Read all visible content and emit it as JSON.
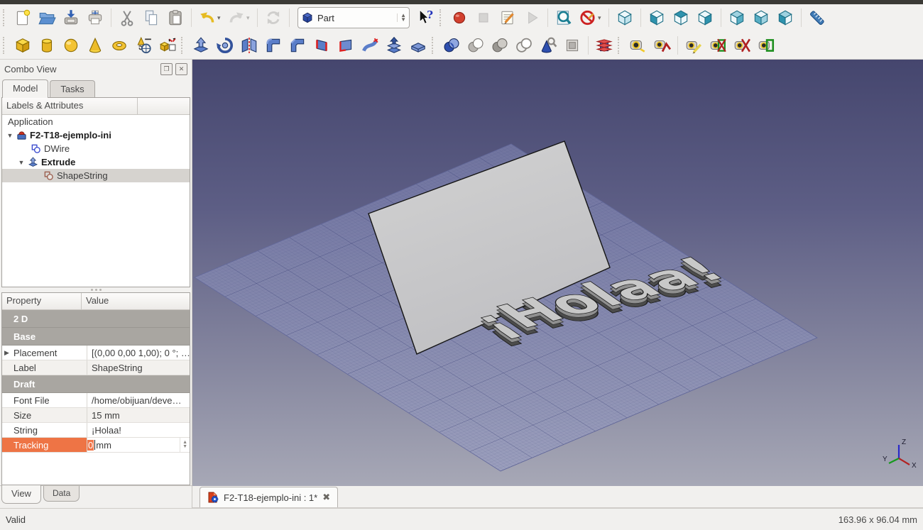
{
  "toolbar": {
    "workbench": {
      "value": "Part"
    },
    "row1_icons": [
      "new-document",
      "open-folder",
      "save",
      "print",
      "cut",
      "copy",
      "paste",
      "undo",
      "redo",
      "refresh",
      "workbench-selector",
      "whats-this",
      "macro-record",
      "macro-stop",
      "macro-edit",
      "macro-play",
      "zoom-fit",
      "draw-style",
      "view-isometric",
      "view-front",
      "view-top",
      "view-right",
      "view-rear",
      "view-bottom",
      "view-left",
      "measure"
    ],
    "row2_icons": [
      "box",
      "cylinder",
      "sphere",
      "cone",
      "torus",
      "create-primitives",
      "shape-builder",
      "extrude",
      "revolve",
      "mirror",
      "fillet",
      "chamfer",
      "ruled-surface",
      "make-face",
      "loft",
      "sweep",
      "thickness",
      "boolean-union",
      "boolean-common",
      "boolean-cut",
      "boolean-section",
      "check-geometry",
      "defeaturing",
      "cross-sections",
      "measure-linear",
      "measure-angular",
      "measure-refresh",
      "measure-toggle-all",
      "measure-toggle-3d",
      "measure-clear"
    ]
  },
  "combo_view": {
    "title": "Combo View",
    "tabs": {
      "model": "Model",
      "tasks": "Tasks"
    },
    "tree": {
      "header": "Labels & Attributes",
      "root": "Application",
      "document_label": "F2-T18-ejemplo-ini",
      "dwire": "DWire",
      "extrude": "Extrude",
      "shapestring": "ShapeString"
    },
    "properties": {
      "col_property": "Property",
      "col_value": "Value",
      "group_2d": "2 D",
      "group_base": "Base",
      "placement_label": "Placement",
      "placement_value": "[(0,00 0,00 1,00); 0 °; …",
      "label_label": "Label",
      "label_value": "ShapeString",
      "group_draft": "Draft",
      "fontfile_label": "Font File",
      "fontfile_value": "/home/obijuan/deve…",
      "size_label": "Size",
      "size_value": "15 mm",
      "string_label": "String",
      "string_value": "¡Holaa!",
      "tracking_label": "Tracking",
      "tracking_value": "0",
      "tracking_unit": "mm"
    },
    "bottom_tabs": {
      "view": "View",
      "data": "Data"
    }
  },
  "viewport": {
    "document_tab": "F2-T18-ejemplo-ini : 1*",
    "shape_text": "¡Holaa!",
    "axis_x": "X",
    "axis_y": "Y",
    "axis_z": "Z"
  },
  "status_bar": {
    "left": "Valid",
    "right": "163.96 x 96.04 mm"
  },
  "colors": {
    "selection_orange": "#f0764a",
    "viewport_top": "#45466e",
    "viewport_bottom": "#a7a8b6",
    "part_blue": "#5b7ec9",
    "primitive_yellow": "#f0c22a",
    "view_teal": "#2e93ae"
  }
}
